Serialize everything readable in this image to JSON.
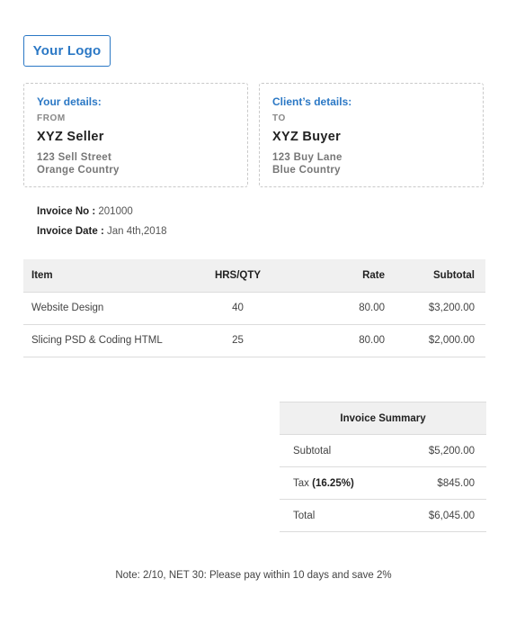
{
  "logo": "Your Logo",
  "seller": {
    "heading": "Your details:",
    "direction": "FROM",
    "name": "XYZ Seller",
    "address1": "123 Sell Street",
    "address2": "Orange Country"
  },
  "buyer": {
    "heading": "Client’s details:",
    "direction": "TO",
    "name": "XYZ Buyer",
    "address1": "123 Buy Lane",
    "address2": "Blue Country"
  },
  "invoice": {
    "no_label": "Invoice No :",
    "no_value": "201000",
    "date_label": "Invoice Date :",
    "date_value": "Jan 4th,2018"
  },
  "items_table": {
    "headers": [
      "Item",
      "HRS/QTY",
      "Rate",
      "Subtotal"
    ],
    "rows": [
      [
        "Website Design",
        "40",
        "80.00",
        "$3,200.00"
      ],
      [
        "Slicing PSD & Coding HTML",
        "25",
        "80.00",
        "$2,000.00"
      ]
    ]
  },
  "summary": {
    "title": "Invoice Summary",
    "subtotal_label": "Subtotal",
    "subtotal_value": "$5,200.00",
    "tax_label": "Tax",
    "tax_rate": "(16.25%)",
    "tax_value": "$845.00",
    "total_label": "Total",
    "total_value": "$6,045.00"
  },
  "note": "Note: 2/10, NET 30: Please pay within 10 days and save 2%"
}
